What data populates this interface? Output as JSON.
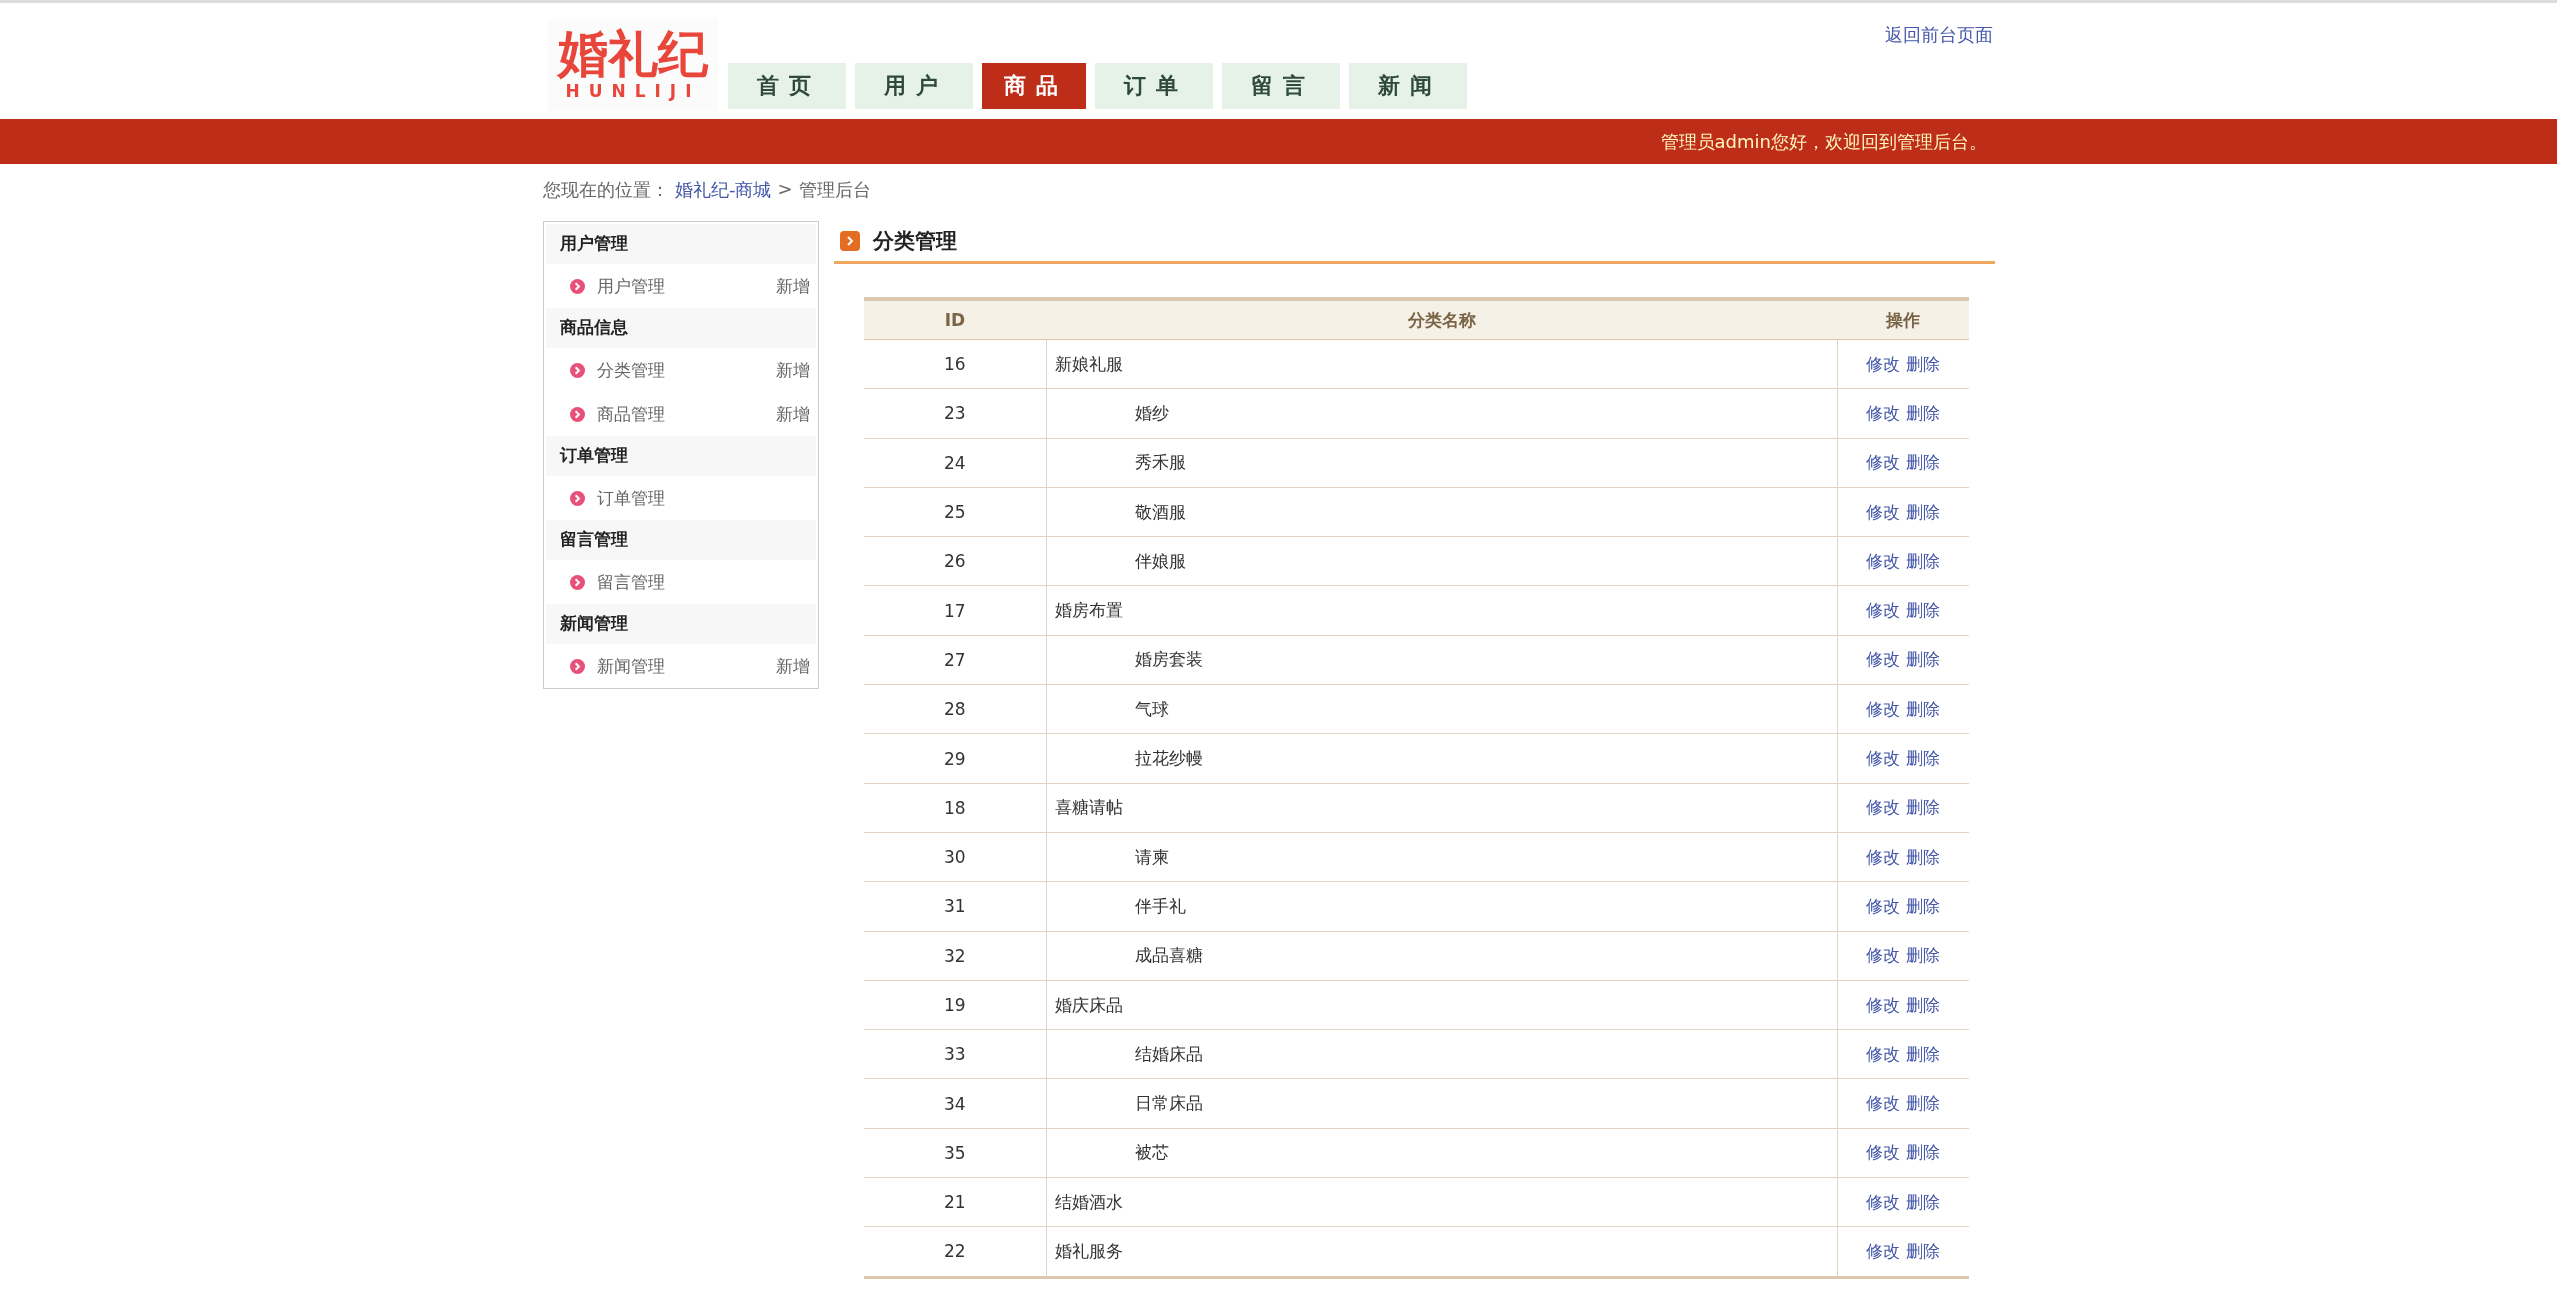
{
  "header": {
    "logo": {
      "title": "婚礼纪",
      "subtitle": "HUNLIJI"
    },
    "back_link": "返回前台页面",
    "nav": [
      {
        "label": "首页",
        "selected": false
      },
      {
        "label": "用户",
        "selected": false
      },
      {
        "label": "商品",
        "selected": true
      },
      {
        "label": "订单",
        "selected": false
      },
      {
        "label": "留言",
        "selected": false
      },
      {
        "label": "新闻",
        "selected": false
      }
    ],
    "welcome": "管理员admin您好，欢迎回到管理后台。"
  },
  "breadcrumb": {
    "prefix": "您现在的位置：",
    "link": "婚礼纪-商城",
    "separator": ">",
    "current": "管理后台"
  },
  "sidebar": [
    {
      "title": "用户管理",
      "items": [
        {
          "label": "用户管理",
          "add": "新增"
        }
      ]
    },
    {
      "title": "商品信息",
      "items": [
        {
          "label": "分类管理",
          "add": "新增"
        },
        {
          "label": "商品管理",
          "add": "新增"
        }
      ]
    },
    {
      "title": "订单管理",
      "items": [
        {
          "label": "订单管理"
        }
      ]
    },
    {
      "title": "留言管理",
      "items": [
        {
          "label": "留言管理"
        }
      ]
    },
    {
      "title": "新闻管理",
      "items": [
        {
          "label": "新闻管理",
          "add": "新增"
        }
      ]
    }
  ],
  "main": {
    "title": "分类管理",
    "table": {
      "columns": [
        "ID",
        "分类名称",
        "操作"
      ],
      "rows": [
        {
          "id": "16",
          "name": "新娘礼服",
          "actions": [
            "修改",
            "删除"
          ],
          "children": [
            {
              "id": "23",
              "name": "婚纱",
              "actions": [
                "修改",
                "删除"
              ]
            },
            {
              "id": "24",
              "name": "秀禾服",
              "actions": [
                "修改",
                "删除"
              ]
            },
            {
              "id": "25",
              "name": "敬酒服",
              "actions": [
                "修改",
                "删除"
              ]
            },
            {
              "id": "26",
              "name": "伴娘服",
              "actions": [
                "修改",
                "删除"
              ]
            }
          ]
        },
        {
          "id": "17",
          "name": "婚房布置",
          "actions": [
            "修改",
            "删除"
          ],
          "children": [
            {
              "id": "27",
              "name": "婚房套装",
              "actions": [
                "修改",
                "删除"
              ]
            },
            {
              "id": "28",
              "name": "气球",
              "actions": [
                "修改",
                "删除"
              ]
            },
            {
              "id": "29",
              "name": "拉花纱幔",
              "actions": [
                "修改",
                "删除"
              ]
            }
          ]
        },
        {
          "id": "18",
          "name": "喜糖请帖",
          "actions": [
            "修改",
            "删除"
          ],
          "children": [
            {
              "id": "30",
              "name": "请柬",
              "actions": [
                "修改",
                "删除"
              ]
            },
            {
              "id": "31",
              "name": "伴手礼",
              "actions": [
                "修改",
                "删除"
              ]
            },
            {
              "id": "32",
              "name": "成品喜糖",
              "actions": [
                "修改",
                "删除"
              ]
            }
          ]
        },
        {
          "id": "19",
          "name": "婚庆床品",
          "actions": [
            "修改",
            "删除"
          ],
          "children": [
            {
              "id": "33",
              "name": "结婚床品",
              "actions": [
                "修改",
                "删除"
              ]
            },
            {
              "id": "34",
              "name": "日常床品",
              "actions": [
                "修改",
                "删除"
              ]
            },
            {
              "id": "35",
              "name": "被芯",
              "actions": [
                "修改",
                "删除"
              ]
            }
          ]
        },
        {
          "id": "21",
          "name": "结婚酒水",
          "actions": [
            "修改",
            "删除"
          ]
        },
        {
          "id": "22",
          "name": "婚礼服务",
          "actions": [
            "修改",
            "删除"
          ]
        }
      ]
    }
  }
}
